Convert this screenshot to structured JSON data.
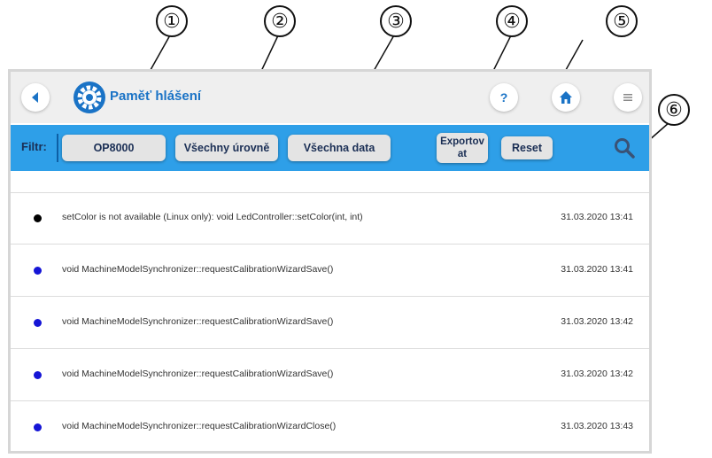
{
  "callouts": [
    "①",
    "②",
    "③",
    "④",
    "⑤",
    "⑥"
  ],
  "header": {
    "title": "Paměť hlášení",
    "back_icon": "back-arrow-icon",
    "settings_icon": "gear-icon",
    "help_label": "?",
    "home_icon": "home-icon",
    "menu_icon": "menu-icon"
  },
  "toolbar": {
    "filter_label": "Filtr:",
    "device_label": "OP8000",
    "levels_label": "Všechny úrovně",
    "data_label": "Všechna data",
    "export_label": "Exportovat",
    "reset_label": "Reset",
    "search_icon": "search-icon"
  },
  "messages": [
    {
      "text": "setColor is not available (Linux only): void LedController::setColor(int, int)",
      "timestamp": "31.03.2020 13:41",
      "level_color": "#000000"
    },
    {
      "text": "void MachineModelSynchronizer::requestCalibrationWizardSave()",
      "timestamp": "31.03.2020 13:41",
      "level_color": "#1515d6"
    },
    {
      "text": "void MachineModelSynchronizer::requestCalibrationWizardSave()",
      "timestamp": "31.03.2020 13:42",
      "level_color": "#1515d6"
    },
    {
      "text": "void MachineModelSynchronizer::requestCalibrationWizardSave()",
      "timestamp": "31.03.2020 13:42",
      "level_color": "#1515d6"
    },
    {
      "text": "void MachineModelSynchronizer::requestCalibrationWizardClose()",
      "timestamp": "31.03.2020 13:43",
      "level_color": "#1515d6"
    }
  ],
  "colors": {
    "accent": "#2e9fe8",
    "title": "#1a73c6",
    "header_bg": "#efefef"
  }
}
